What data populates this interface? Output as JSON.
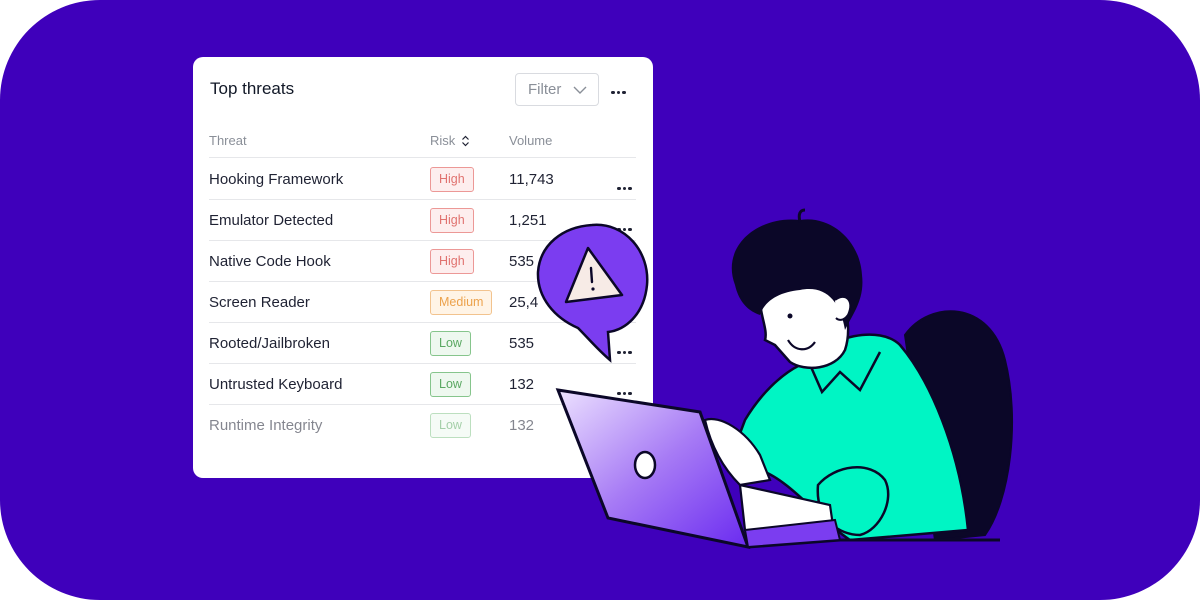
{
  "colors": {
    "background": "#3f00bb",
    "card": "#ffffff",
    "high": "#e0726f",
    "medium": "#eca24c",
    "low": "#5aa862",
    "shirt": "#00f5c4",
    "bubble": "#7b3df0"
  },
  "card": {
    "title": "Top threats",
    "filter_label": "Filter",
    "filter_icon": "chevron-down-icon",
    "more_icon": "more-horizontal-icon",
    "columns": {
      "threat": "Threat",
      "risk": "Risk",
      "risk_sort_icon": "sort-icon",
      "volume": "Volume"
    },
    "rows": [
      {
        "threat": "Hooking Framework",
        "risk": "High",
        "level": "high",
        "volume": "11,743",
        "menu": true
      },
      {
        "threat": "Emulator Detected",
        "risk": "High",
        "level": "high",
        "volume": "1,251",
        "menu": true
      },
      {
        "threat": "Native Code Hook",
        "risk": "High",
        "level": "high",
        "volume": "535",
        "menu": false
      },
      {
        "threat": "Screen Reader",
        "risk": "Medium",
        "level": "medium",
        "volume": "25,4",
        "menu": false
      },
      {
        "threat": "Rooted/Jailbroken",
        "risk": "Low",
        "level": "low",
        "volume": "535",
        "menu": true
      },
      {
        "threat": "Untrusted Keyboard",
        "risk": "Low",
        "level": "low",
        "volume": "132",
        "menu": true
      },
      {
        "threat": "Runtime Integrity",
        "risk": "Low",
        "level": "low",
        "volume": "132",
        "menu": false
      }
    ]
  },
  "illustration": {
    "warning_icon": "warning-triangle-icon",
    "person": "person-at-laptop"
  }
}
